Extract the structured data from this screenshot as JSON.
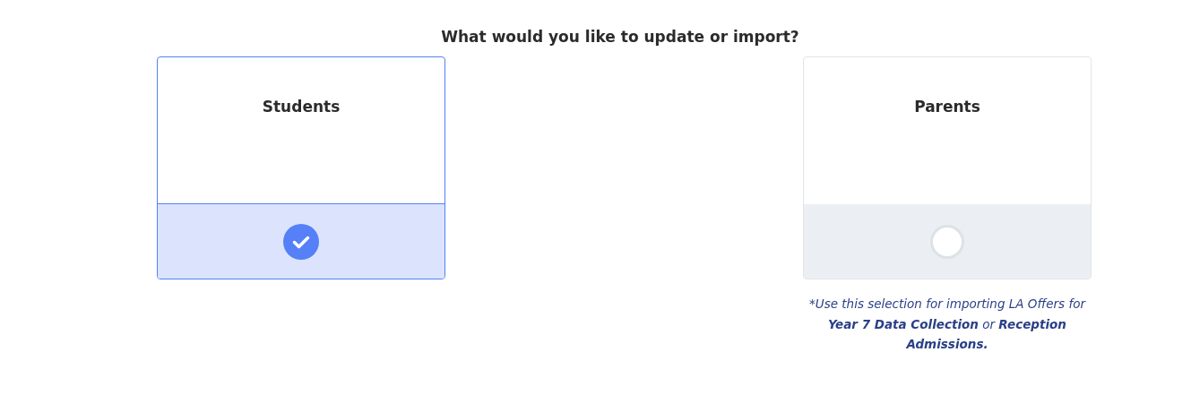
{
  "heading": "What would you like to update or import?",
  "options": [
    {
      "label": "Students",
      "selected": true
    },
    {
      "label": "Parents",
      "selected": false,
      "note": "*Use this selection for importing LA Offers for **Year 7 Data Collection** or **Reception Admissions.**"
    }
  ]
}
